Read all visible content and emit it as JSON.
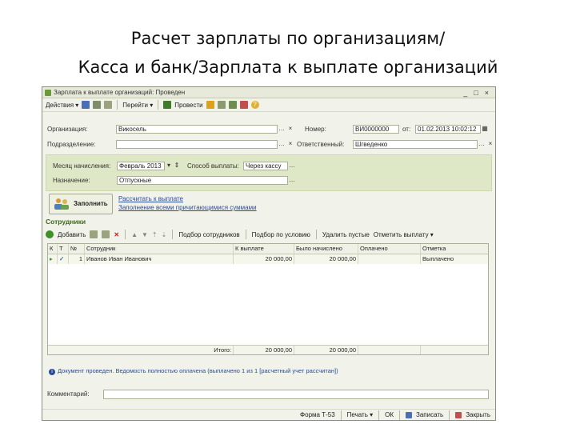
{
  "slide": {
    "title_line1": "Расчет зарплаты по организациям/",
    "title_line2": "Касса и банк/Зарплата к выплате организаций"
  },
  "window": {
    "title": "Зарплата к выплате организаций: Проведен",
    "min": "_",
    "max": "□",
    "close": "×"
  },
  "toolbar": {
    "actions": "Действия ▾",
    "goto": "Перейти ▾",
    "post": "Провести",
    "help": "?"
  },
  "header": {
    "org_label": "Организация:",
    "org_value": "Викосель",
    "number_label": "Номер:",
    "number_value": "ВИ0000000",
    "date_sep": "от:",
    "date_value": "01.02.2013 10:02:12",
    "dept_label": "Подразделение:",
    "resp_label": "Ответственный:",
    "resp_value": "Шгведенко"
  },
  "period": {
    "month_label": "Месяц начисления:",
    "month_value": "Февраль 2013",
    "method_label": "Способ выплаты:",
    "method_value": "Через кассу",
    "type_label": "Назначение:",
    "type_value": "Отпускные"
  },
  "fill": {
    "button_label": "Заполнить",
    "link1": "Рассчитать к выплате",
    "link2": "Заполнение всеми причитающимися суммами"
  },
  "employees": {
    "section_title": "Сотрудники",
    "add": "Добавить",
    "pick": "Подбор сотрудников",
    "pick_cond": "Подбор по условию",
    "delete_empty": "Удалить пустые",
    "mark_all": "Отметить выплату ▾"
  },
  "grid": {
    "headers": [
      "К",
      "Т",
      "№",
      "Сотрудник",
      "К выплате",
      "Было начислено",
      "Оплачено",
      "Отметка"
    ],
    "rows": [
      [
        "",
        "✓",
        "1",
        "Иванов Иван Иванович",
        "20 000,00",
        "20 000,00",
        "",
        "Выплачено"
      ]
    ],
    "footer_label": "Итого:",
    "footer_total": "20 000,00",
    "footer_accrued": "20 000,00"
  },
  "info": {
    "text": "Документ проведен. Ведомость полностью оплачена (выплачено 1 из 1 [расчетный учет рассчитан])"
  },
  "comment": {
    "label": "Комментарий:"
  },
  "bottom": {
    "form": "Форма Т-53",
    "print": "Печать ▾",
    "ok": "ОК",
    "save": "Записать",
    "close": "Закрыть"
  }
}
